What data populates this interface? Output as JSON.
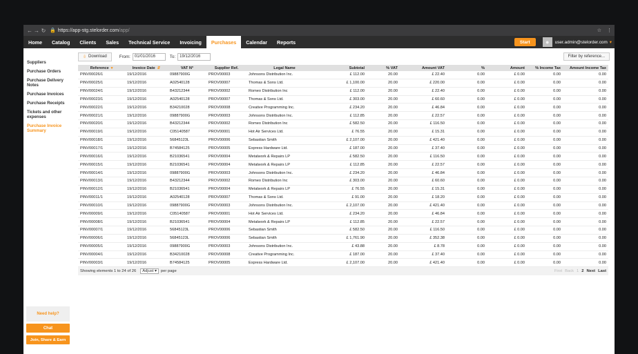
{
  "browser": {
    "url_host": "https://app-stg.stelorder.com",
    "url_path": "/app/"
  },
  "nav": {
    "items": [
      "Home",
      "Catalog",
      "Clients",
      "Sales",
      "Technical Service",
      "Invoicing",
      "Purchases",
      "Calendar",
      "Reports"
    ],
    "active": "Purchases",
    "start_label": "Start",
    "user_email": "user.admin@stelorder.com"
  },
  "sidebar": {
    "items": [
      "Suppliers",
      "Purchase Orders",
      "Purchase Delivery Notes",
      "Purchase Invoices",
      "Purchase Receipts",
      "Tickets and other expenses",
      "Purchase Invoice Summary"
    ],
    "active_index": 6,
    "help_label": "Need help?",
    "chat_label": "Chat",
    "join_label": "Join, Share & Earn"
  },
  "toolbar": {
    "download_label": "Download",
    "from_label": "From:",
    "from_value": "01/01/2016",
    "to_label": "To:",
    "to_value": "19/12/2016",
    "filter_label": "Filter by reference..."
  },
  "table": {
    "headers": [
      "Reference",
      "Invoice Date",
      "VAT N°",
      "Supplier Ref.",
      "Legal Name",
      "Subtotal",
      "% VAT",
      "Amount VAT",
      "%",
      "Amount",
      "% Income Tax",
      "Amount Income Tax"
    ],
    "rows": [
      [
        "PINV00026/1",
        "19/12/2016",
        "09887900G",
        "PROV00003",
        "Johnsons Distribution Inc.",
        "£ 112.00",
        "20.00",
        "£ 22.40",
        "0.00",
        "£ 0.00",
        "0.00",
        "0.00"
      ],
      [
        "PINV00025/1",
        "19/12/2016",
        "A02540128",
        "PROV00007",
        "Thomas & Sons Ltd.",
        "£ 1,100.00",
        "20.00",
        "£ 220.00",
        "0.00",
        "£ 0.00",
        "0.00",
        "0.00"
      ],
      [
        "PINV00024/1",
        "19/12/2016",
        "B43212344",
        "PROV00002",
        "Romeo Distribution Inc",
        "£ 112.00",
        "20.00",
        "£ 22.40",
        "0.00",
        "£ 0.00",
        "0.00",
        "0.00"
      ],
      [
        "PINV00023/1",
        "19/12/2016",
        "A02540128",
        "PROV00007",
        "Thomas & Sons Ltd.",
        "£ 303.00",
        "20.00",
        "£ 60.60",
        "0.00",
        "£ 0.00",
        "0.00",
        "0.00"
      ],
      [
        "PINV00022/1",
        "19/12/2016",
        "B34210028",
        "PROV00008",
        "Creative Programming Inc.",
        "£ 234.20",
        "20.00",
        "£ 46.84",
        "0.00",
        "£ 0.00",
        "0.00",
        "0.00"
      ],
      [
        "PINV00021/1",
        "19/12/2016",
        "09887900G",
        "PROV00003",
        "Johnsons Distribution Inc.",
        "£ 112.85",
        "20.00",
        "£ 22.57",
        "0.00",
        "£ 0.00",
        "0.00",
        "0.00"
      ],
      [
        "PINV00020/1",
        "19/12/2016",
        "B43212344",
        "PROV00002",
        "Romeo Distribution Inc",
        "£ 582.50",
        "20.00",
        "£ 116.50",
        "0.00",
        "£ 0.00",
        "0.00",
        "0.00"
      ],
      [
        "PINV00019/1",
        "19/12/2016",
        "C05140587",
        "PROV00001",
        "Hot Air Services Ltd.",
        "£ 76.55",
        "20.00",
        "£ 15.31",
        "0.00",
        "£ 0.00",
        "0.00",
        "0.00"
      ],
      [
        "PINV00018/1",
        "19/12/2016",
        "56845123L",
        "PROV00006",
        "Sebastian Smith",
        "£ 2,107.00",
        "20.00",
        "£ 421.40",
        "0.00",
        "£ 0.00",
        "0.00",
        "0.00"
      ],
      [
        "PINV00017/1",
        "19/12/2016",
        "B74584125",
        "PROV00005",
        "Express Hardware Ltd.",
        "£ 187.00",
        "20.00",
        "£ 37.40",
        "0.00",
        "£ 0.00",
        "0.00",
        "0.00"
      ],
      [
        "PINV00016/1",
        "19/12/2016",
        "B21036541",
        "PROV00004",
        "Metalwork & Repairs LP",
        "£ 582.50",
        "20.00",
        "£ 116.50",
        "0.00",
        "£ 0.00",
        "0.00",
        "0.00"
      ],
      [
        "PINV00015/1",
        "19/12/2016",
        "B21036541",
        "PROV00004",
        "Metalwork & Repairs LP",
        "£ 112.85",
        "20.00",
        "£ 22.57",
        "0.00",
        "£ 0.00",
        "0.00",
        "0.00"
      ],
      [
        "PINV00014/1",
        "19/12/2016",
        "09887900G",
        "PROV00003",
        "Johnsons Distribution Inc.",
        "£ 234.20",
        "20.00",
        "£ 46.84",
        "0.00",
        "£ 0.00",
        "0.00",
        "0.00"
      ],
      [
        "PINV00013/1",
        "19/12/2016",
        "B43212344",
        "PROV00002",
        "Romeo Distribution Inc",
        "£ 303.00",
        "20.00",
        "£ 60.60",
        "0.00",
        "£ 0.00",
        "0.00",
        "0.00"
      ],
      [
        "PINV00012/1",
        "19/12/2016",
        "B21036541",
        "PROV00004",
        "Metalwork & Repairs LP",
        "£ 76.55",
        "20.00",
        "£ 15.31",
        "0.00",
        "£ 0.00",
        "0.00",
        "0.00"
      ],
      [
        "PINV00011/1",
        "19/12/2016",
        "A02540128",
        "PROV00007",
        "Thomas & Sons Ltd.",
        "£ 91.00",
        "20.00",
        "£ 18.20",
        "0.00",
        "£ 0.00",
        "0.00",
        "0.00"
      ],
      [
        "PINV00010/1",
        "19/12/2016",
        "09887900G",
        "PROV00003",
        "Johnsons Distribution Inc.",
        "£ 2,107.00",
        "20.00",
        "£ 421.40",
        "0.00",
        "£ 0.00",
        "0.00",
        "0.00"
      ],
      [
        "PINV00009/1",
        "19/12/2016",
        "C05140587",
        "PROV00001",
        "Hot Air Services Ltd.",
        "£ 234.20",
        "20.00",
        "£ 46.84",
        "0.00",
        "£ 0.00",
        "0.00",
        "0.00"
      ],
      [
        "PINV00008/1",
        "19/12/2016",
        "B21036541",
        "PROV00004",
        "Metalwork & Repairs LP",
        "£ 112.85",
        "20.00",
        "£ 22.57",
        "0.00",
        "£ 0.00",
        "0.00",
        "0.00"
      ],
      [
        "PINV00007/1",
        "19/12/2016",
        "56845123L",
        "PROV00006",
        "Sebastian Smith",
        "£ 582.50",
        "20.00",
        "£ 116.50",
        "0.00",
        "£ 0.00",
        "0.00",
        "0.00"
      ],
      [
        "PINV00006/1",
        "19/12/2016",
        "56845123L",
        "PROV00006",
        "Sebastian Smith",
        "£ 1,761.90",
        "20.00",
        "£ 352.38",
        "0.00",
        "£ 0.00",
        "0.00",
        "0.00"
      ],
      [
        "PINV00005/1",
        "19/12/2016",
        "09887900G",
        "PROV00003",
        "Johnsons Distribution Inc.",
        "£ 43.88",
        "20.00",
        "£ 8.78",
        "0.00",
        "£ 0.00",
        "0.00",
        "0.00"
      ],
      [
        "PINV00004/1",
        "19/12/2016",
        "B34210028",
        "PROV00008",
        "Creative Programming Inc.",
        "£ 187.00",
        "20.00",
        "£ 37.40",
        "0.00",
        "£ 0.00",
        "0.00",
        "0.00"
      ],
      [
        "PINV00003/1",
        "19/12/2016",
        "B74584125",
        "PROV00005",
        "Express Hardware Ltd.",
        "£ 2,107.00",
        "20.00",
        "£ 421.40",
        "0.00",
        "£ 0.00",
        "0.00",
        "0.00"
      ]
    ]
  },
  "footer": {
    "showing": "Showing elements 1 to 24 of 26",
    "per_page_value": "Adjust",
    "per_page_label": "per page",
    "pager": {
      "first": "First",
      "back": "Back",
      "page1": "1",
      "page2": "2",
      "next": "Next",
      "last": "Last"
    }
  },
  "colors": {
    "accent": "#f7941d",
    "nav_bg": "#2d2d2d",
    "header_bg": "#e0e0e0"
  }
}
